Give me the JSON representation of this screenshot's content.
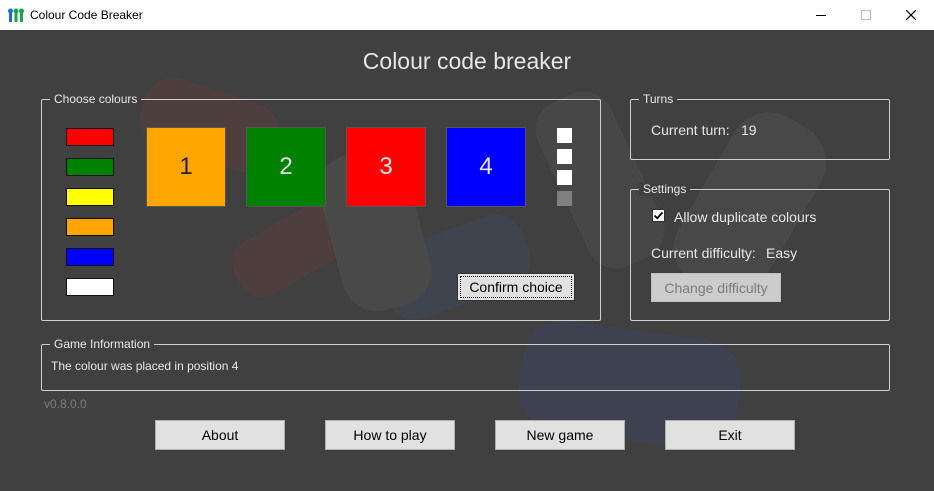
{
  "window": {
    "title": "Colour Code Breaker",
    "icon": "app-icon",
    "controls": [
      "minimize-icon",
      "maximize-icon",
      "close-icon"
    ]
  },
  "heading": "Colour code breaker",
  "choose_colours": {
    "legend": "Choose colours",
    "palette": [
      {
        "name": "red",
        "color": "#ff0000"
      },
      {
        "name": "green",
        "color": "#008000"
      },
      {
        "name": "yellow",
        "color": "#ffff00"
      },
      {
        "name": "orange",
        "color": "#ffa500"
      },
      {
        "name": "blue",
        "color": "#0000ff"
      },
      {
        "name": "white",
        "color": "#ffffff"
      }
    ],
    "slots": [
      {
        "label": "1",
        "color": "#ffa500",
        "text_color": "#222222"
      },
      {
        "label": "2",
        "color": "#008000",
        "text_color": "#e6e6e6"
      },
      {
        "label": "3",
        "color": "#ff0000",
        "text_color": "#e6e6e6"
      },
      {
        "label": "4",
        "color": "#0000ff",
        "text_color": "#e6e6e6"
      }
    ],
    "feedback_pegs": [
      "#ffffff",
      "#ffffff",
      "#ffffff",
      "#808080"
    ],
    "confirm_label": "Confirm choice"
  },
  "turns": {
    "legend": "Turns",
    "current_turn_label": "Current turn:",
    "current_turn_value": "19"
  },
  "settings": {
    "legend": "Settings",
    "allow_duplicates_label": "Allow duplicate colours",
    "allow_duplicates_checked": true,
    "difficulty_label": "Current difficulty:",
    "difficulty_value": "Easy",
    "change_difficulty_label": "Change difficulty"
  },
  "game_info": {
    "legend": "Game Information",
    "message": "The colour was placed in position 4"
  },
  "version": "v0.8.0.0",
  "bottom_buttons": {
    "about": "About",
    "how_to_play": "How to play",
    "new_game": "New game",
    "exit": "Exit"
  },
  "colors": {
    "background": "#404040",
    "text": "#e6e6e6",
    "button": "#e1e1e1"
  }
}
